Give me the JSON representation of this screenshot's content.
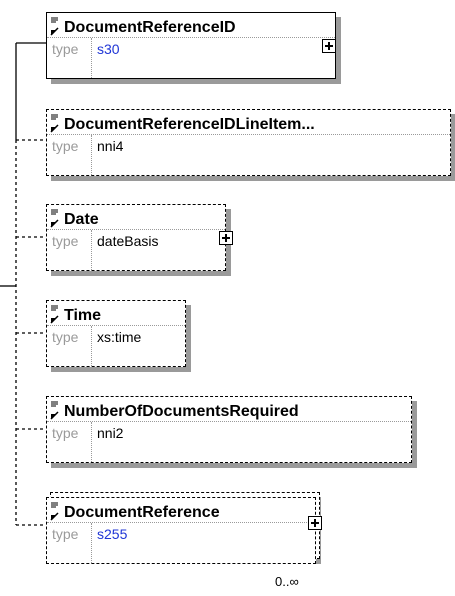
{
  "elements": [
    {
      "name": "DocumentReferenceID",
      "type_label": "type",
      "type_value": "s30"
    },
    {
      "name": "DocumentReferenceIDLineItem...",
      "type_label": "type",
      "type_value": "nni4"
    },
    {
      "name": "Date",
      "type_label": "type",
      "type_value": "dateBasis"
    },
    {
      "name": "Time",
      "type_label": "type",
      "type_value": "xs:time"
    },
    {
      "name": "NumberOfDocumentsRequired",
      "type_label": "type",
      "type_value": "nni2"
    },
    {
      "name": "DocumentReference",
      "type_label": "type",
      "type_value": "s255"
    }
  ],
  "occurrence": "0..∞"
}
